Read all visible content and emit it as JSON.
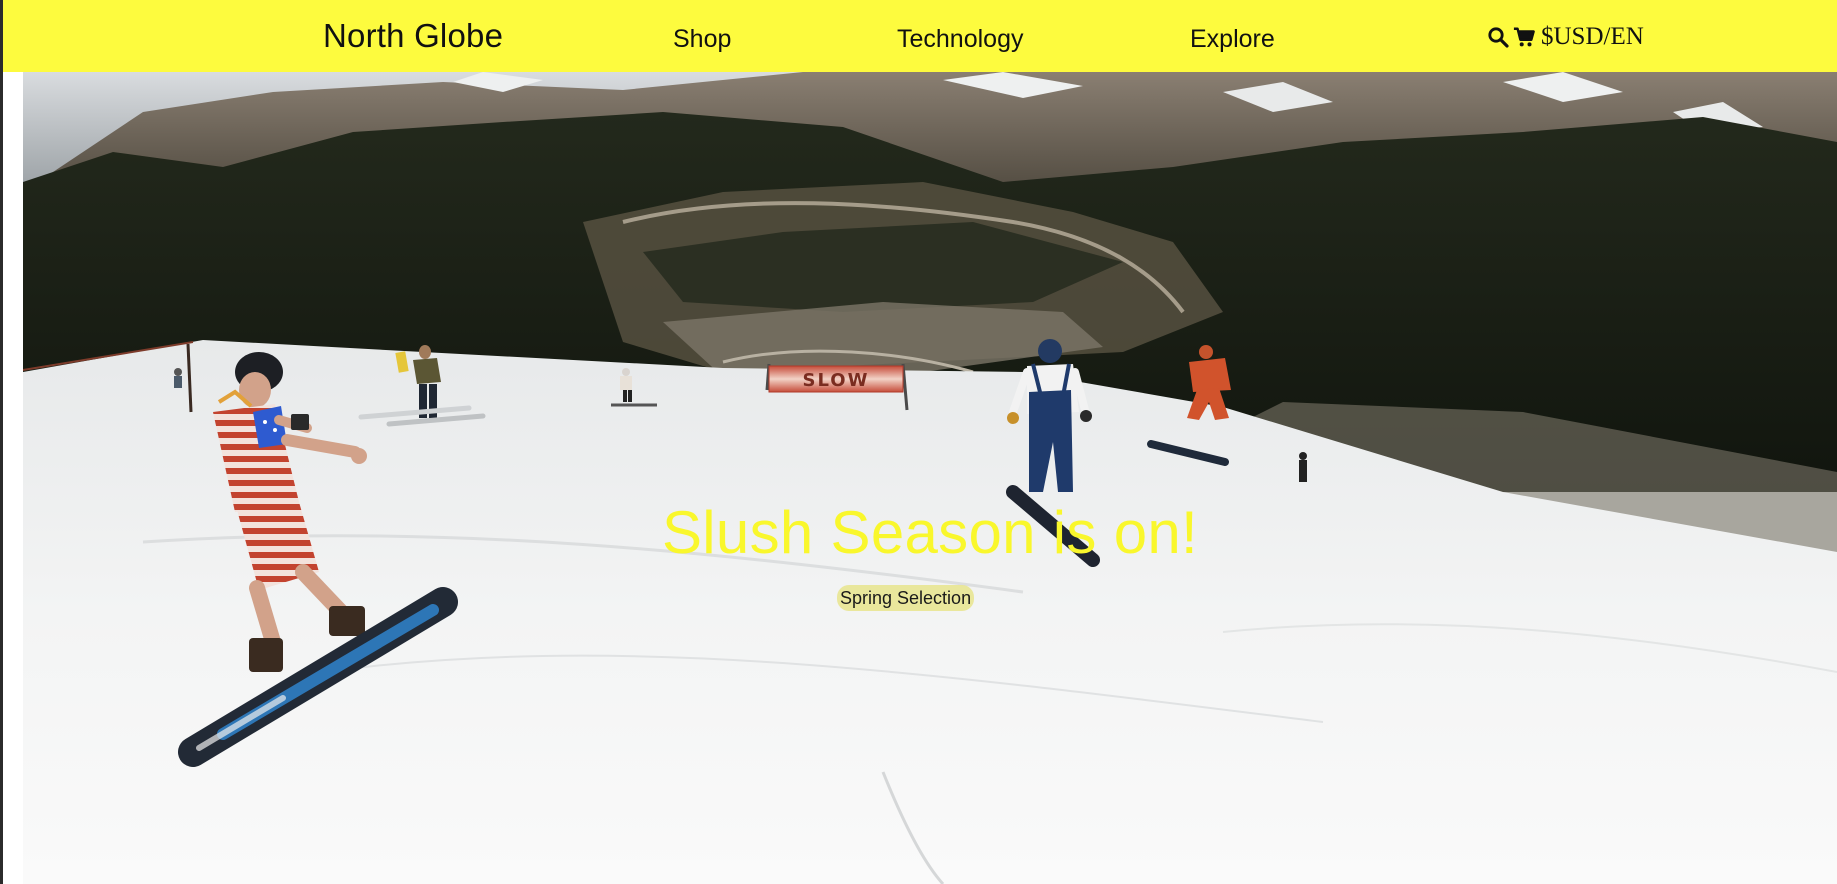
{
  "header": {
    "brand": "North Globe",
    "nav": {
      "shop": "Shop",
      "technology": "Technology",
      "explore": "Explore"
    },
    "tools": {
      "search_icon": "search-icon",
      "cart_icon": "cart-icon",
      "currency_language": "$USD/EN"
    }
  },
  "hero": {
    "title": "Slush Season is on!",
    "cta": "Spring Selection",
    "sign_text": "SLOW",
    "image": "snowboarders-on-spring-ski-slope"
  },
  "colors": {
    "header_background": "#fdfb3e",
    "hero_title": "#f9f72c",
    "cta_background": "#e8e48c",
    "text": "#111111"
  }
}
